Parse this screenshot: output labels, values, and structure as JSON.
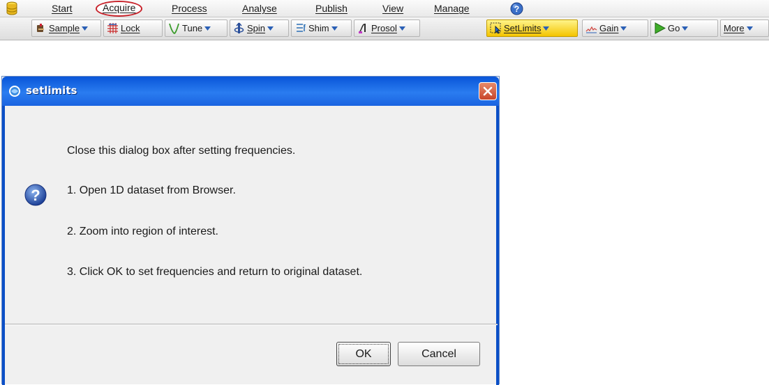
{
  "menubar": {
    "items": [
      {
        "label": "Start"
      },
      {
        "label": "Acquire",
        "active": true
      },
      {
        "label": "Process"
      },
      {
        "label": "Analyse"
      },
      {
        "label": "Publish"
      },
      {
        "label": "View"
      },
      {
        "label": "Manage"
      }
    ],
    "icons": {
      "database": "database-icon",
      "help": "help-icon"
    }
  },
  "toolbar": {
    "buttons": [
      {
        "label": "Sample",
        "icon": "sample-icon",
        "dropdown": true
      },
      {
        "label": "Lock",
        "icon": "lock-icon",
        "dropdown": false
      },
      {
        "label": "Tune",
        "icon": "tune-icon",
        "dropdown": true
      },
      {
        "label": "Spin",
        "icon": "spin-icon",
        "dropdown": true
      },
      {
        "label": "Shim",
        "icon": "shim-icon",
        "dropdown": true
      },
      {
        "label": "Prosol",
        "icon": "prosol-icon",
        "dropdown": true
      },
      {
        "label": "SetLimits",
        "icon": "setlimits-icon",
        "dropdown": true,
        "highlighted": true
      },
      {
        "label": "Gain",
        "icon": "gain-icon",
        "dropdown": true
      },
      {
        "label": "Go",
        "icon": "go-icon",
        "dropdown": true
      },
      {
        "label": "More",
        "icon": "",
        "dropdown": true
      }
    ],
    "highlight_color": "#f4c400"
  },
  "dialog": {
    "title": "setlimits",
    "message_lines": [
      "Close this dialog box after setting frequencies.",
      "1. Open 1D dataset from Browser.",
      "2. Zoom into region of interest.",
      "3. Click OK to set frequencies and return to original dataset."
    ],
    "ok_label": "OK",
    "cancel_label": "Cancel",
    "icon": "question-icon",
    "titlebar_color": "#0955d8"
  }
}
